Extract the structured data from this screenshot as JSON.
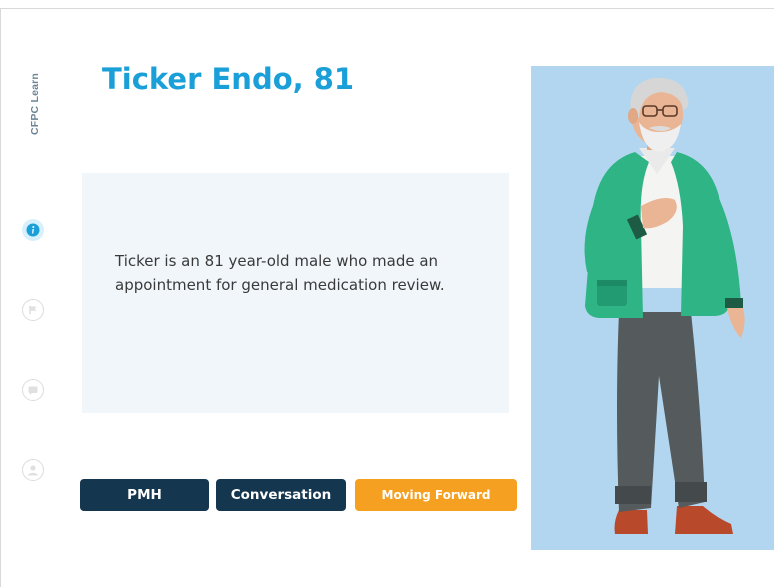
{
  "brand": {
    "text": "CFPC Learn"
  },
  "nav": {
    "items": [
      {
        "icon": "info-icon",
        "state": "active"
      },
      {
        "icon": "flag-icon",
        "state": "inactive"
      },
      {
        "icon": "chat-icon",
        "state": "inactive"
      },
      {
        "icon": "user-icon",
        "state": "inactive"
      }
    ]
  },
  "main": {
    "title": "Ticker Endo, 81",
    "description": "Ticker is an 81 year-old male who made an appointment for general medication review."
  },
  "actions": {
    "pmh_label": "PMH",
    "conversation_label": "Conversation",
    "moving_forward_label": "Moving Forward"
  },
  "colors": {
    "accent": "#1a9fd8",
    "dark_button": "#14364f",
    "orange_button": "#f5a020",
    "card_bg": "#f0f6fa",
    "illustration_bg": "#b3d6f0"
  }
}
